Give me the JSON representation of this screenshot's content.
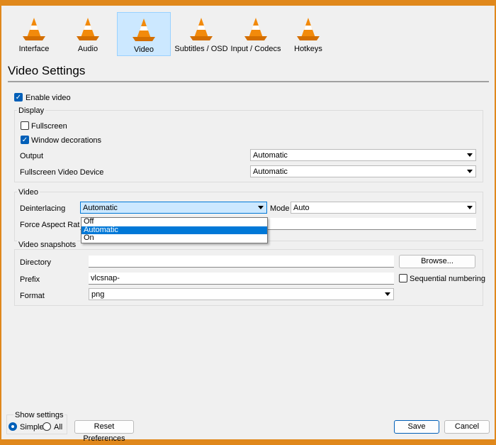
{
  "categories": [
    {
      "label": "Interface",
      "icon": "interface-cone-icon",
      "selected": false
    },
    {
      "label": "Audio",
      "icon": "audio-cone-icon",
      "selected": false
    },
    {
      "label": "Video",
      "icon": "video-cone-icon",
      "selected": true
    },
    {
      "label": "Subtitles / OSD",
      "icon": "subtitles-cone-icon",
      "selected": false
    },
    {
      "label": "Input / Codecs",
      "icon": "input-cone-icon",
      "selected": false
    },
    {
      "label": "Hotkeys",
      "icon": "hotkeys-cone-icon",
      "selected": false
    }
  ],
  "title": "Video Settings",
  "enable_video": {
    "label": "Enable video",
    "checked": true
  },
  "display": {
    "title": "Display",
    "fullscreen": "Fullscreen",
    "window_decorations": "Window decorations",
    "output_label": "Output",
    "output_value": "Automatic",
    "fs_device_label": "Fullscreen Video Device",
    "fs_device_value": "Automatic"
  },
  "video": {
    "title": "Video",
    "deint_label": "Deinterlacing",
    "deint_value": "Automatic",
    "mode_label": "Mode",
    "mode_value": "Auto",
    "aspect_label": "Force Aspect Ratio",
    "aspect_value": "",
    "options": [
      "Off",
      "Automatic",
      "On"
    ],
    "highlighted": "Automatic"
  },
  "snapshots": {
    "title": "Video snapshots",
    "dir_label": "Directory",
    "dir_value": "",
    "browse": "Browse...",
    "prefix_label": "Prefix",
    "prefix_value": "vlcsnap-",
    "sequential": "Sequential numbering",
    "format_label": "Format",
    "format_value": "png"
  },
  "footer": {
    "show_settings": "Show settings",
    "simple": "Simple",
    "all": "All",
    "reset": "Reset Preferences",
    "save": "Save",
    "cancel": "Cancel"
  },
  "colors": {
    "accent": "#005fb8",
    "cone": "#f28a0b",
    "selection": "#0078d7"
  }
}
